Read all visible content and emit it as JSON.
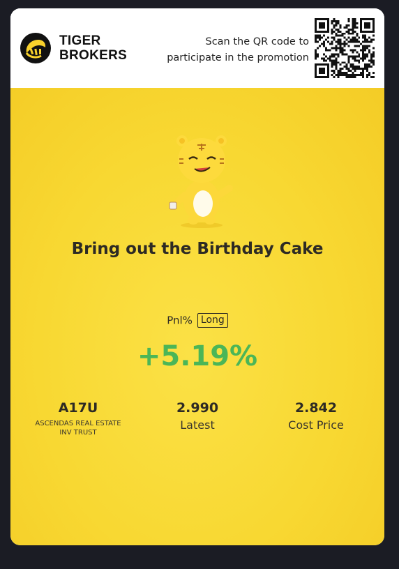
{
  "brand": {
    "line1": "TIGER",
    "line2": "BROKERS"
  },
  "header": {
    "scan_line1": "Scan the QR code to",
    "scan_line2": "participate in the promotion"
  },
  "promo": {
    "headline": "Bring out the Birthday Cake",
    "pnl_label": "Pnl%",
    "position_tag": "Long",
    "pnl_value": "+5.19%"
  },
  "stock": {
    "symbol": "A17U",
    "name_line1": "ASCENDAS REAL ESTATE",
    "name_line2": "INV TRUST",
    "latest_value": "2.990",
    "latest_label": "Latest",
    "cost_value": "2.842",
    "cost_label": "Cost Price"
  },
  "colors": {
    "promo_bg": "#f8d832",
    "gain_green": "#4bb657",
    "page_bg": "#1b1c24"
  },
  "icons": [
    "tiger-brokers-logo-icon",
    "qr-code-icon",
    "tiger-mascot-icon"
  ]
}
